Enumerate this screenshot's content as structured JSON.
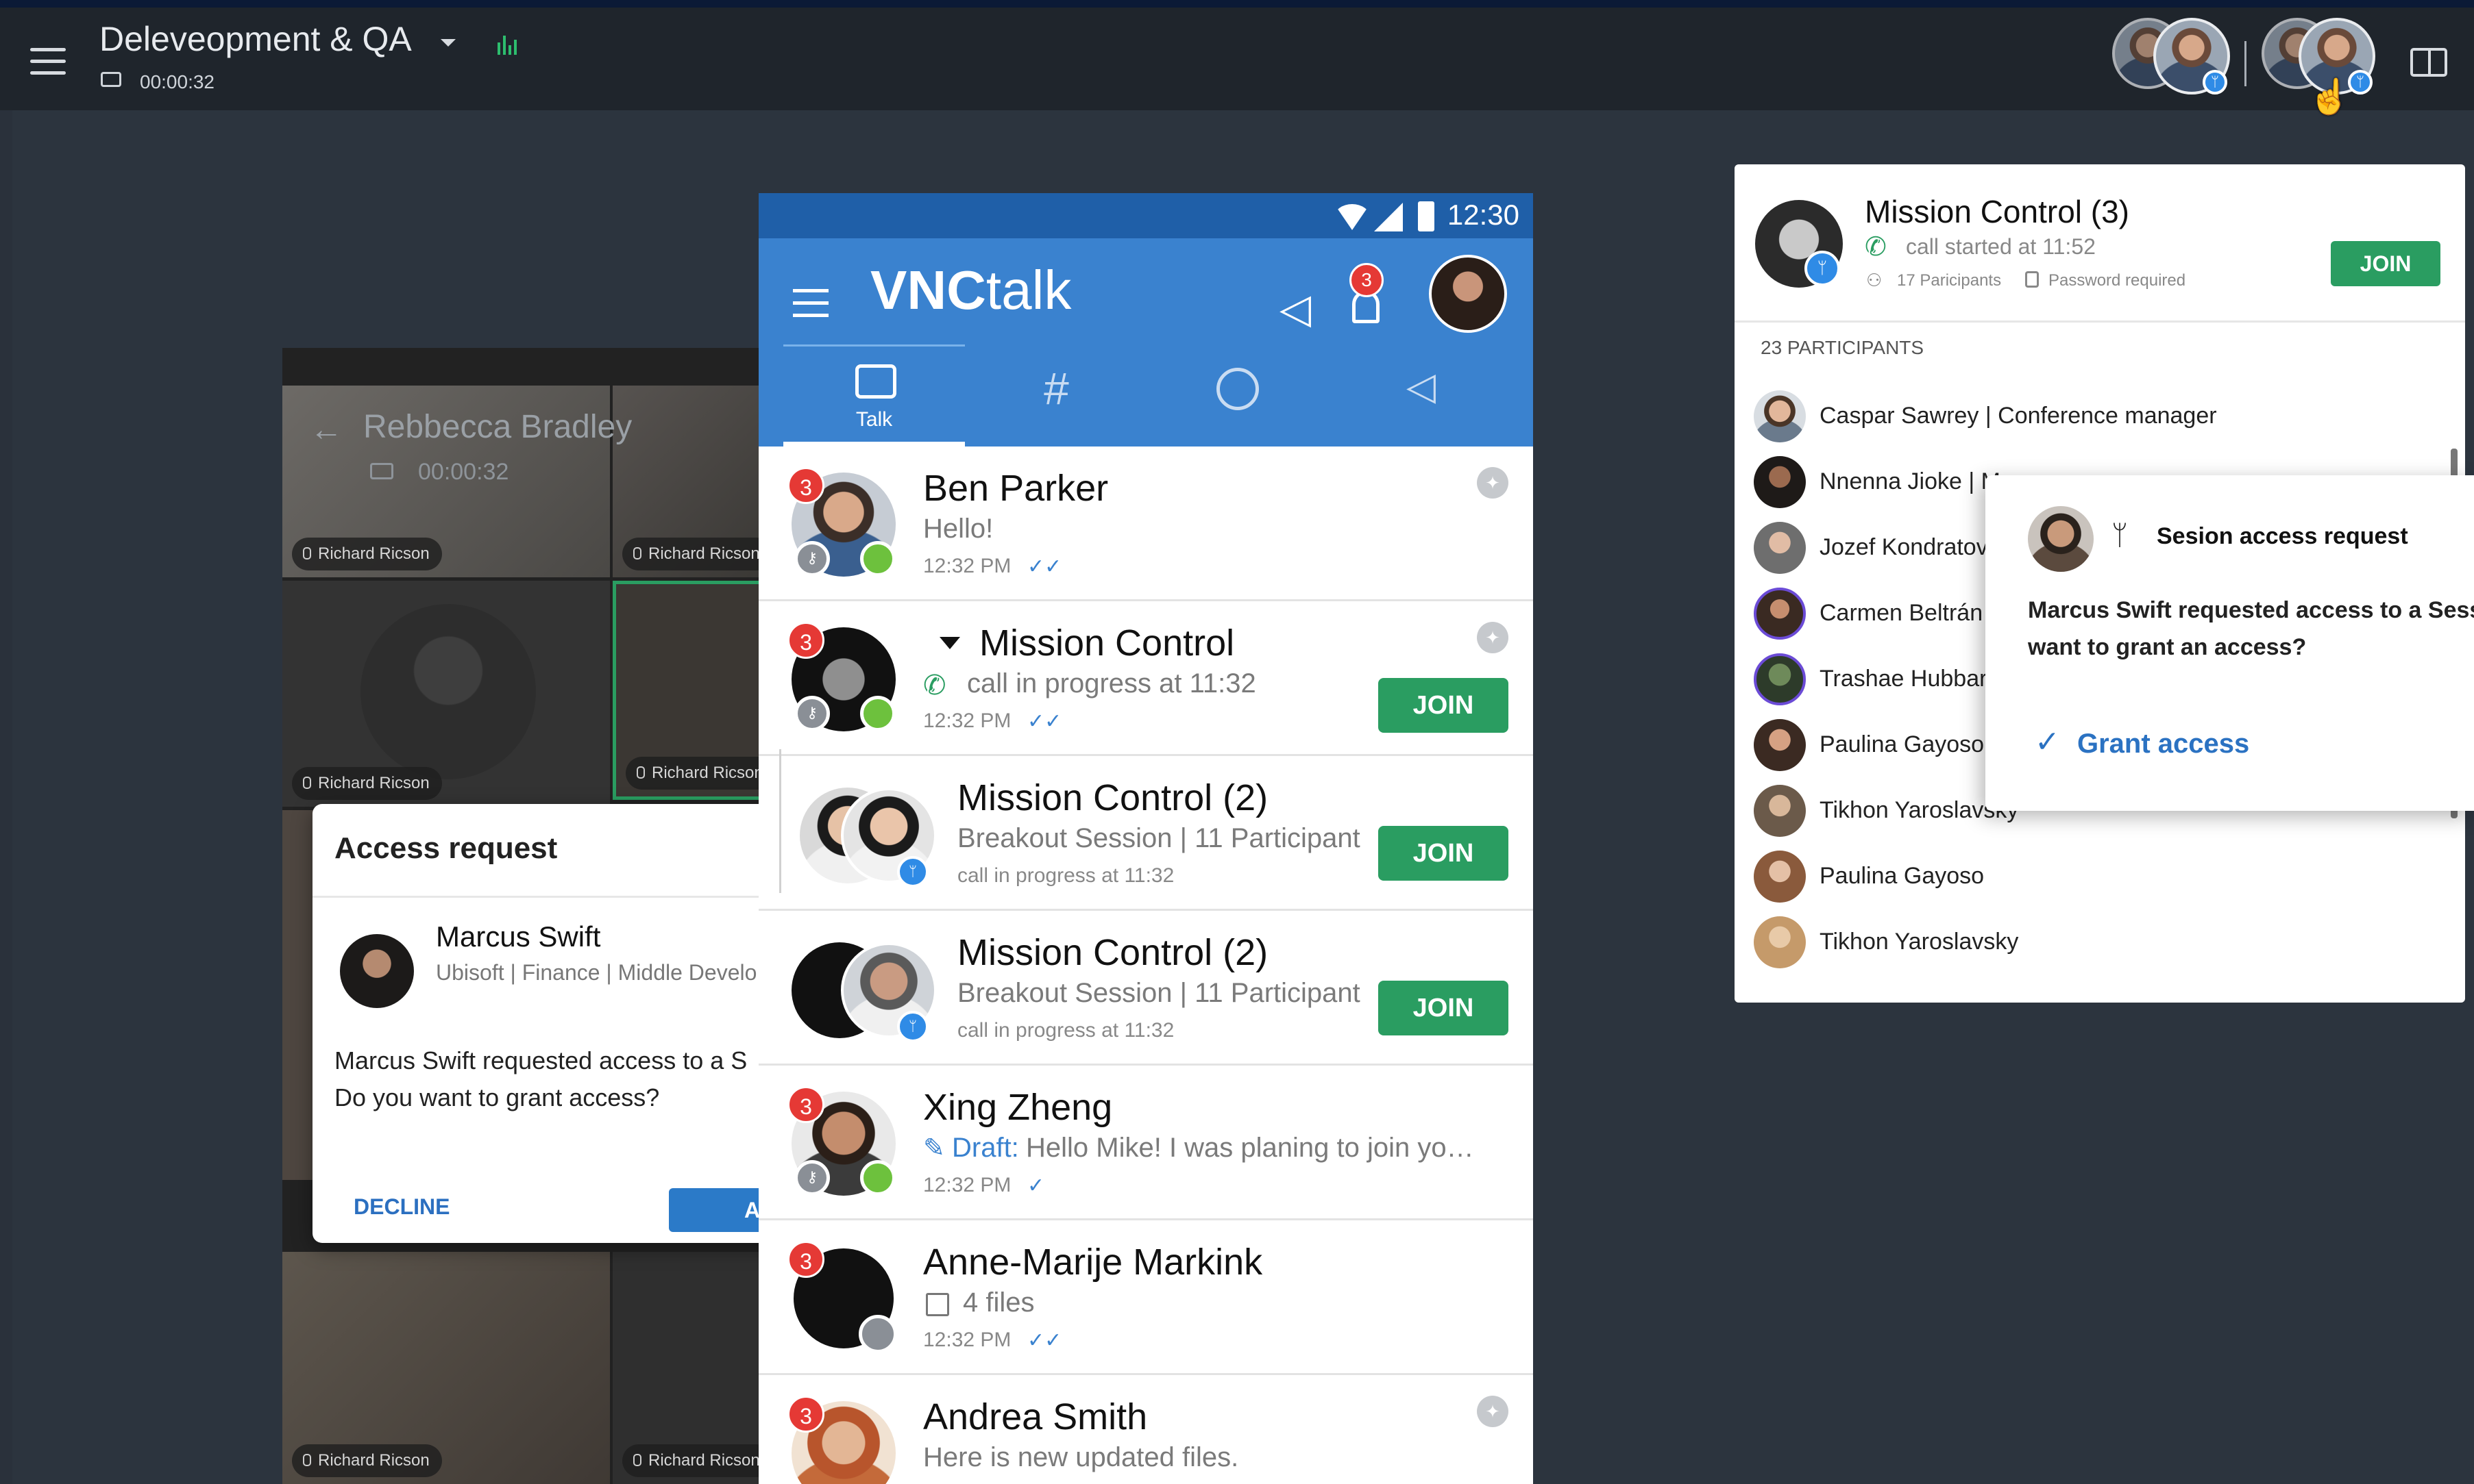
{
  "header": {
    "title": "Deleveopment & QA",
    "timer": "00:00:32"
  },
  "video": {
    "caller_name": "Rebbecca Bradley",
    "caller_timer": "00:00:32",
    "tile_label": "Richard Ricson"
  },
  "access_request_card": {
    "heading": "Access request",
    "name": "Marcus Swift",
    "subtitle": "Ubisoft | Finance | Middle Develo",
    "message": "Marcus Swift requested access to a S\nDo you want to grant access?",
    "decline_label": "DECLINE",
    "accept_label": "A"
  },
  "phone": {
    "status_time": "12:30",
    "app_name_bold": "VNC",
    "app_name_light": "talk",
    "notification_count": "3",
    "tabs": [
      {
        "label": "Talk"
      }
    ],
    "chats": [
      {
        "name": "Ben Parker",
        "preview": "Hello!",
        "time": "12:32 PM",
        "count": "3"
      },
      {
        "name": "Mission Control",
        "preview": "call in progress at 11:32",
        "time": "12:32 PM",
        "count": "3",
        "join": "JOIN"
      },
      {
        "name": "Mission Control (2)",
        "preview": "Breakout Session | 11 Participant",
        "time": "call in progress at 11:32",
        "join": "JOIN"
      },
      {
        "name": "Mission Control (2)",
        "preview": "Breakout Session | 11 Participant",
        "time": "call in progress at 11:32",
        "join": "JOIN"
      },
      {
        "name": "Xing Zheng",
        "draft_label": "Draft:",
        "preview": "Hello Mike! I was planing to join yo…",
        "time": "12:32 PM",
        "count": "3"
      },
      {
        "name": "Anne-Marije Markink",
        "preview": "4 files",
        "time": "12:32 PM",
        "count": "3"
      },
      {
        "name": "Andrea Smith",
        "preview": "Here is new updated files.",
        "count": "3"
      }
    ]
  },
  "call_panel": {
    "title": "Mission Control (3)",
    "started": "call started at 11:52",
    "participants_meta": "17 Paricipants",
    "password_meta": "Password required",
    "join_label": "JOIN",
    "participant_count": "23 PARTICIPANTS",
    "participants": [
      "Caspar Sawrey  | Conference manager",
      "Nnenna Jioke  | M",
      "Jozef Kondratov",
      "Carmen Beltrán",
      "Trashae Hubbar",
      "Paulina Gayoso",
      "Tikhon Yaroslavsky",
      "Paulina Gayoso",
      "Tikhon Yaroslavsky"
    ]
  },
  "session_popover": {
    "heading": "Sesion access request",
    "message": "Marcus Swift requested access to a Sessio\nwant to grant an access?",
    "grant_label": "Grant access"
  },
  "colors": {
    "brand_blue": "#3a82cf",
    "join_green": "#2a9d61",
    "badge_red": "#e53935",
    "online_green": "#6dc13d"
  }
}
